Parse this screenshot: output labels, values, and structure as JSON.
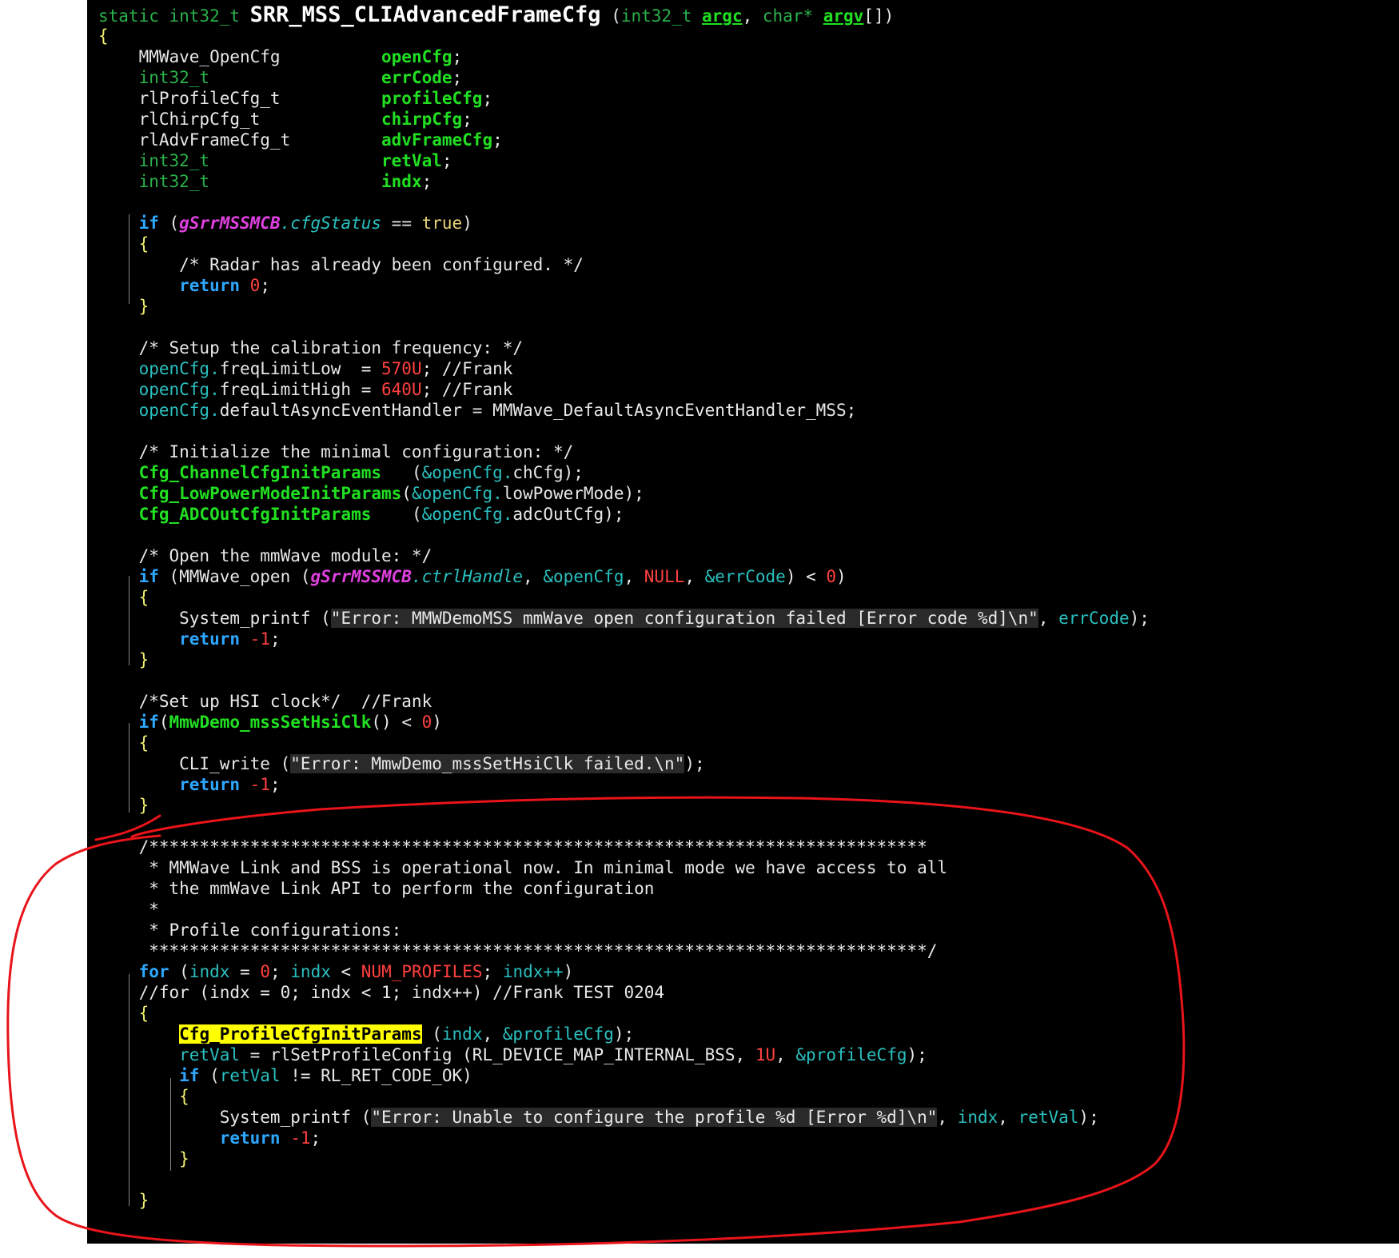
{
  "lines": [
    [
      [
        "tok-type",
        "static int32_t "
      ],
      [
        "tok-fnbig",
        "SRR_MSS_CLIAdvancedFrameCfg"
      ],
      [
        "tok-plain",
        " ("
      ],
      [
        "tok-type",
        "int32_t "
      ],
      [
        "tok-param",
        "argc"
      ],
      [
        "tok-plain",
        ", "
      ],
      [
        "tok-type",
        "char* "
      ],
      [
        "tok-param",
        "argv"
      ],
      [
        "tok-plain",
        "[])"
      ]
    ],
    [
      [
        "tok-brace",
        "{"
      ]
    ],
    [
      [
        "tok-plain",
        "    MMWave_OpenCfg          "
      ],
      [
        "tok-var",
        "openCfg"
      ],
      [
        "tok-plain",
        ";"
      ]
    ],
    [
      [
        "tok-type",
        "    int32_t                 "
      ],
      [
        "tok-var",
        "errCode"
      ],
      [
        "tok-plain",
        ";"
      ]
    ],
    [
      [
        "tok-plain",
        "    rlProfileCfg_t          "
      ],
      [
        "tok-var",
        "profileCfg"
      ],
      [
        "tok-plain",
        ";"
      ]
    ],
    [
      [
        "tok-plain",
        "    rlChirpCfg_t            "
      ],
      [
        "tok-var",
        "chirpCfg"
      ],
      [
        "tok-plain",
        ";"
      ]
    ],
    [
      [
        "tok-plain",
        "    rlAdvFrameCfg_t         "
      ],
      [
        "tok-var",
        "advFrameCfg"
      ],
      [
        "tok-plain",
        ";"
      ]
    ],
    [
      [
        "tok-type",
        "    int32_t                 "
      ],
      [
        "tok-var",
        "retVal"
      ],
      [
        "tok-plain",
        ";"
      ]
    ],
    [
      [
        "tok-type",
        "    int32_t                 "
      ],
      [
        "tok-var",
        "indx"
      ],
      [
        "tok-plain",
        ";"
      ]
    ],
    [],
    [
      [
        "tok-kw",
        "    if"
      ],
      [
        "tok-plain",
        " ("
      ],
      [
        "tok-global",
        "gSrrMSSMCB"
      ],
      [
        "tok-memberi",
        ".cfgStatus"
      ],
      [
        "tok-plain",
        " == "
      ],
      [
        "tok-const",
        "true"
      ],
      [
        "tok-plain",
        ")"
      ]
    ],
    [
      [
        "tok-brace",
        "    {"
      ]
    ],
    [
      [
        "tok-comment",
        "        /* Radar has already been configured. */"
      ]
    ],
    [
      [
        "tok-kw",
        "        return"
      ],
      [
        "tok-plain",
        " "
      ],
      [
        "tok-num",
        "0"
      ],
      [
        "tok-plain",
        ";"
      ]
    ],
    [
      [
        "tok-brace",
        "    }"
      ]
    ],
    [],
    [
      [
        "tok-comment",
        "    /* Setup the calibration frequency: */"
      ]
    ],
    [
      [
        "tok-member",
        "    openCfg."
      ],
      [
        "tok-plain",
        "freqLimitLow  = "
      ],
      [
        "tok-num",
        "570U"
      ],
      [
        "tok-plain",
        "; //Frank"
      ]
    ],
    [
      [
        "tok-member",
        "    openCfg."
      ],
      [
        "tok-plain",
        "freqLimitHigh = "
      ],
      [
        "tok-num",
        "640U"
      ],
      [
        "tok-plain",
        "; //Frank"
      ]
    ],
    [
      [
        "tok-member",
        "    openCfg."
      ],
      [
        "tok-plain",
        "defaultAsyncEventHandler = MMWave_DefaultAsyncEventHandler_MSS;"
      ]
    ],
    [],
    [
      [
        "tok-comment",
        "    /* Initialize the minimal configuration: */"
      ]
    ],
    [
      [
        "tok-fn",
        "    Cfg_ChannelCfgInitParams"
      ],
      [
        "tok-plain",
        "   ("
      ],
      [
        "tok-member",
        "&openCfg."
      ],
      [
        "tok-plain",
        "chCfg);"
      ]
    ],
    [
      [
        "tok-fn",
        "    Cfg_LowPowerModeInitParams"
      ],
      [
        "tok-plain",
        "("
      ],
      [
        "tok-member",
        "&openCfg."
      ],
      [
        "tok-plain",
        "lowPowerMode);"
      ]
    ],
    [
      [
        "tok-fn",
        "    Cfg_ADCOutCfgInitParams"
      ],
      [
        "tok-plain",
        "    ("
      ],
      [
        "tok-member",
        "&openCfg."
      ],
      [
        "tok-plain",
        "adcOutCfg);"
      ]
    ],
    [],
    [
      [
        "tok-comment",
        "    /* Open the mmWave module: */"
      ]
    ],
    [
      [
        "tok-kw",
        "    if"
      ],
      [
        "tok-plain",
        " (MMWave_open ("
      ],
      [
        "tok-global",
        "gSrrMSSMCB"
      ],
      [
        "tok-memberi",
        ".ctrlHandle"
      ],
      [
        "tok-plain",
        ", "
      ],
      [
        "tok-member",
        "&openCfg"
      ],
      [
        "tok-plain",
        ", "
      ],
      [
        "tok-macro",
        "NULL"
      ],
      [
        "tok-plain",
        ", "
      ],
      [
        "tok-member",
        "&errCode"
      ],
      [
        "tok-plain",
        ") < "
      ],
      [
        "tok-num",
        "0"
      ],
      [
        "tok-plain",
        ")"
      ]
    ],
    [
      [
        "tok-brace",
        "    {"
      ]
    ],
    [
      [
        "tok-plain",
        "        System_printf ("
      ],
      [
        "tok-str",
        "\"Error: MMWDemoMSS mmWave open configuration failed [Error code %d]\\n\""
      ],
      [
        "tok-plain",
        ", "
      ],
      [
        "tok-member",
        "errCode"
      ],
      [
        "tok-plain",
        ");"
      ]
    ],
    [
      [
        "tok-kw",
        "        return"
      ],
      [
        "tok-plain",
        " "
      ],
      [
        "tok-num",
        "-1"
      ],
      [
        "tok-plain",
        ";"
      ]
    ],
    [
      [
        "tok-brace",
        "    }"
      ]
    ],
    [],
    [
      [
        "tok-comment",
        "    /*Set up HSI clock*/  //Frank"
      ]
    ],
    [
      [
        "tok-kw",
        "    if"
      ],
      [
        "tok-plain",
        "("
      ],
      [
        "tok-fn",
        "MmwDemo_mssSetHsiClk"
      ],
      [
        "tok-plain",
        "() < "
      ],
      [
        "tok-num",
        "0"
      ],
      [
        "tok-plain",
        ")"
      ]
    ],
    [
      [
        "tok-brace",
        "    {"
      ]
    ],
    [
      [
        "tok-plain",
        "        CLI_write ("
      ],
      [
        "tok-str",
        "\"Error: MmwDemo_mssSetHsiClk failed.\\n\""
      ],
      [
        "tok-plain",
        ");"
      ]
    ],
    [
      [
        "tok-kw",
        "        return"
      ],
      [
        "tok-plain",
        " "
      ],
      [
        "tok-num",
        "-1"
      ],
      [
        "tok-plain",
        ";"
      ]
    ],
    [
      [
        "tok-brace",
        "    }"
      ]
    ],
    [],
    [
      [
        "tok-comment",
        "    /*****************************************************************************"
      ]
    ],
    [
      [
        "tok-comment",
        "     * MMWave Link and BSS is operational now. In minimal mode we have access to all"
      ]
    ],
    [
      [
        "tok-comment",
        "     * the mmWave Link API to perform the configuration"
      ]
    ],
    [
      [
        "tok-comment",
        "     *"
      ]
    ],
    [
      [
        "tok-comment",
        "     * Profile configurations:"
      ]
    ],
    [
      [
        "tok-comment",
        "     *****************************************************************************/"
      ]
    ],
    [
      [
        "tok-kw",
        "    for"
      ],
      [
        "tok-plain",
        " ("
      ],
      [
        "tok-member",
        "indx"
      ],
      [
        "tok-plain",
        " = "
      ],
      [
        "tok-num",
        "0"
      ],
      [
        "tok-plain",
        "; "
      ],
      [
        "tok-member",
        "indx"
      ],
      [
        "tok-plain",
        " < "
      ],
      [
        "tok-macro",
        "NUM_PROFILES"
      ],
      [
        "tok-plain",
        "; "
      ],
      [
        "tok-member",
        "indx++"
      ],
      [
        "tok-plain",
        ")"
      ]
    ],
    [
      [
        "tok-comment",
        "    //for (indx = 0; indx < 1; indx++) //Frank TEST 0204"
      ]
    ],
    [
      [
        "tok-brace",
        "    {"
      ]
    ],
    [
      [
        "tok-plain",
        "        "
      ],
      [
        "tok-hl",
        "Cfg_ProfileCfgInitParams"
      ],
      [
        "tok-plain",
        " ("
      ],
      [
        "tok-member",
        "indx"
      ],
      [
        "tok-plain",
        ", "
      ],
      [
        "tok-member",
        "&profileCfg"
      ],
      [
        "tok-plain",
        ");"
      ]
    ],
    [
      [
        "tok-member",
        "        retVal"
      ],
      [
        "tok-plain",
        " = rlSetProfileConfig (RL_DEVICE_MAP_INTERNAL_BSS, "
      ],
      [
        "tok-num",
        "1U"
      ],
      [
        "tok-plain",
        ", "
      ],
      [
        "tok-member",
        "&profileCfg"
      ],
      [
        "tok-plain",
        ");"
      ]
    ],
    [
      [
        "tok-kw",
        "        if"
      ],
      [
        "tok-plain",
        " ("
      ],
      [
        "tok-member",
        "retVal"
      ],
      [
        "tok-plain",
        " != RL_RET_CODE_OK)"
      ]
    ],
    [
      [
        "tok-brace",
        "        {"
      ]
    ],
    [
      [
        "tok-plain",
        "            System_printf ("
      ],
      [
        "tok-str",
        "\"Error: Unable to configure the profile %d [Error %d]\\n\""
      ],
      [
        "tok-plain",
        ", "
      ],
      [
        "tok-member",
        "indx"
      ],
      [
        "tok-plain",
        ", "
      ],
      [
        "tok-member",
        "retVal"
      ],
      [
        "tok-plain",
        ");"
      ]
    ],
    [
      [
        "tok-kw",
        "            return"
      ],
      [
        "tok-plain",
        " "
      ],
      [
        "tok-num",
        "-1"
      ],
      [
        "tok-plain",
        ";"
      ]
    ],
    [
      [
        "tok-brace",
        "        }"
      ]
    ],
    [],
    [
      [
        "tok-brace",
        "    }"
      ]
    ]
  ]
}
